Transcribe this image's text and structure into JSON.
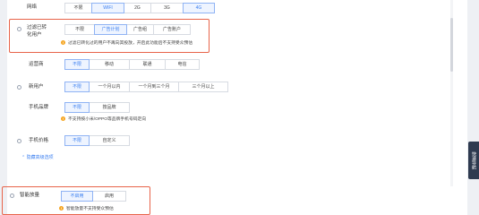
{
  "network": {
    "label": "网络",
    "options": [
      "不限",
      "WIFI",
      "2G",
      "3G",
      "4G"
    ],
    "selected": [
      "WIFI",
      "4G"
    ]
  },
  "filter_converted": {
    "label_line1": "过滤已转",
    "label_line2": "化用户",
    "options": [
      "不限",
      "广告计划",
      "广告组",
      "广告账户"
    ],
    "selected": "广告计划",
    "hint": "过滤已转化过的用户不再向其投放，开启此功能后不支持受众预估"
  },
  "operator": {
    "label": "运营商",
    "options": [
      "不限",
      "移动",
      "联通",
      "电信"
    ],
    "selected": "不限"
  },
  "new_user": {
    "label": "新用户",
    "options": [
      "不限",
      "一个月以内",
      "一个月到三个月",
      "三个月以上"
    ],
    "selected": "不限"
  },
  "phone_brand": {
    "label": "手机品牌",
    "options": [
      "不限",
      "按品牌"
    ],
    "selected": "不限",
    "hint": "不支持按小米/OPPO等品牌手机号码定向"
  },
  "phone_price": {
    "label": "手机价格",
    "options": [
      "不限",
      "自定义"
    ],
    "selected": "不限"
  },
  "advanced_toggle": "隐藏高级选项",
  "smart_release": {
    "label": "智能放量",
    "options": [
      "不启用",
      "启用"
    ],
    "selected": "不启用",
    "hint": "智能放量不支持受众预估"
  },
  "side_tab": "快速导航"
}
